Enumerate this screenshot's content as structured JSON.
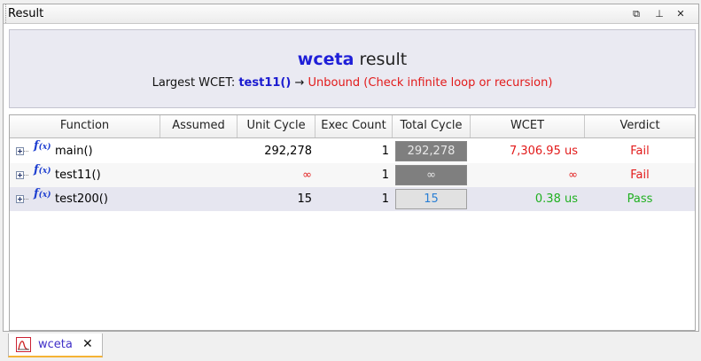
{
  "view": {
    "title": "Result",
    "controls": {
      "restore": "⧉",
      "pin": "⊥",
      "close": "✕"
    }
  },
  "header": {
    "tool": "wceta",
    "title_rest": " result",
    "largest_label": "Largest WCET: ",
    "largest_fn": "test11()",
    "arrow": " → ",
    "verdict": "Unbound (Check infinite loop or recursion)"
  },
  "table": {
    "columns": [
      "Function",
      "Assumed",
      "Unit Cycle",
      "Exec Count",
      "Total Cycle",
      "WCET",
      "Verdict"
    ],
    "rows": [
      {
        "function": "main()",
        "assumed": "",
        "unit_cycle": "292,278",
        "exec_count": "1",
        "total_cycle": "292,278",
        "wcet": "7,306.95 us",
        "verdict": "Fail"
      },
      {
        "function": "test11()",
        "assumed": "",
        "unit_cycle": "∞",
        "exec_count": "1",
        "total_cycle": "∞",
        "wcet": "∞",
        "verdict": "Fail"
      },
      {
        "function": "test200()",
        "assumed": "",
        "unit_cycle": "15",
        "exec_count": "1",
        "total_cycle": "15",
        "wcet": "0.38 us",
        "verdict": "Pass"
      }
    ],
    "fx_icon": "f(x)"
  },
  "tabs": [
    {
      "label": "wceta",
      "icon": "wceta-chart-icon",
      "close": "✕"
    }
  ],
  "colors": {
    "tool_blue": "#1f1fd8",
    "fail_red": "#e21a1a",
    "pass_green": "#20b020",
    "tab_accent": "#f5b335"
  }
}
